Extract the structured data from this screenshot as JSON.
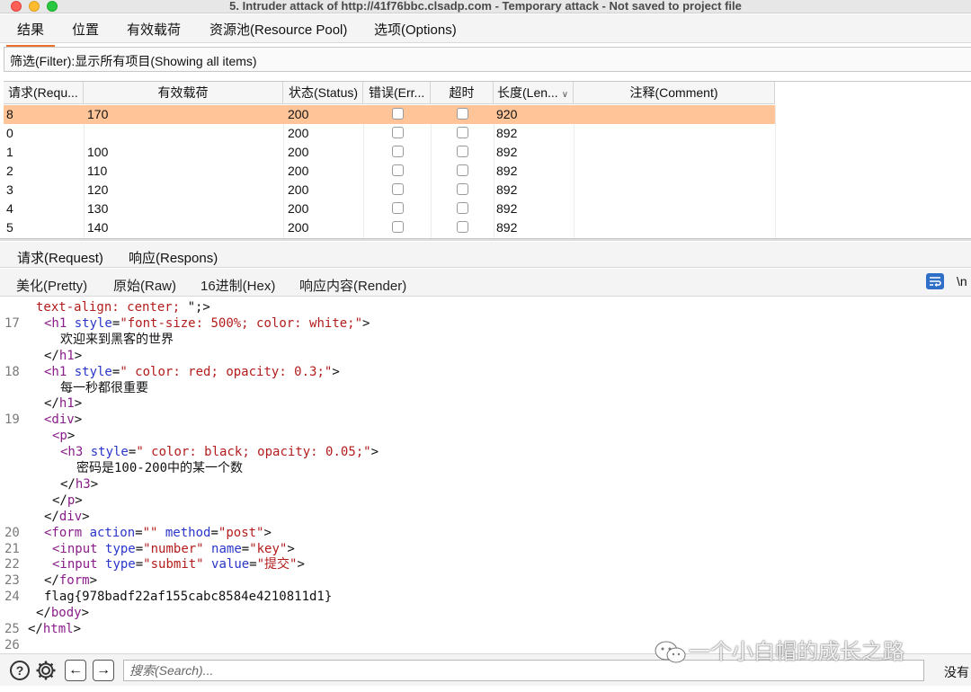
{
  "window": {
    "title": "5. Intruder attack of http://41f76bbc.clsadp.com - Temporary attack - Not saved to project file"
  },
  "main_tabs": [
    {
      "label": "结果",
      "active": true
    },
    {
      "label": "位置",
      "active": false
    },
    {
      "label": "有效载荷",
      "active": false
    },
    {
      "label": "资源池(Resource Pool)",
      "active": false
    },
    {
      "label": "选项(Options)",
      "active": false
    }
  ],
  "filter": {
    "label": "筛选(Filter):显示所有项目(Showing all items)"
  },
  "table": {
    "columns": [
      "请求(Requ...",
      "有效载荷",
      "状态(Status)",
      "错误(Err...",
      "超时",
      "长度(Len...",
      "注释(Comment)"
    ],
    "rows": [
      {
        "request": "8",
        "payload": "170",
        "status": "200",
        "error": false,
        "timeout": false,
        "length": "920",
        "comment": "",
        "selected": true
      },
      {
        "request": "0",
        "payload": "",
        "status": "200",
        "error": false,
        "timeout": false,
        "length": "892",
        "comment": "",
        "selected": false
      },
      {
        "request": "1",
        "payload": "100",
        "status": "200",
        "error": false,
        "timeout": false,
        "length": "892",
        "comment": "",
        "selected": false
      },
      {
        "request": "2",
        "payload": "110",
        "status": "200",
        "error": false,
        "timeout": false,
        "length": "892",
        "comment": "",
        "selected": false
      },
      {
        "request": "3",
        "payload": "120",
        "status": "200",
        "error": false,
        "timeout": false,
        "length": "892",
        "comment": "",
        "selected": false
      },
      {
        "request": "4",
        "payload": "130",
        "status": "200",
        "error": false,
        "timeout": false,
        "length": "892",
        "comment": "",
        "selected": false
      },
      {
        "request": "5",
        "payload": "140",
        "status": "200",
        "error": false,
        "timeout": false,
        "length": "892",
        "comment": "",
        "selected": false
      }
    ],
    "selected_color": "#ffc599"
  },
  "rr_tabs": [
    {
      "label": "请求(Request)",
      "active": false
    },
    {
      "label": "响应(Respons)",
      "active": true
    }
  ],
  "view_tabs": [
    {
      "label": "美化(Pretty)",
      "active": true
    },
    {
      "label": "原始(Raw)",
      "active": false
    },
    {
      "label": "16进制(Hex)",
      "active": false
    },
    {
      "label": "响应内容(Render)",
      "active": false
    }
  ],
  "toolbar_right": {
    "wrap_icon": "wrap-lines-icon",
    "newline_label": "\\n"
  },
  "code_lines": [
    {
      "num": "",
      "indent": 3,
      "tokens": [
        [
          "val",
          "text-align: center; "
        ],
        [
          "plain",
          "\";>"
        ]
      ]
    },
    {
      "num": "17",
      "indent": 4,
      "tokens": [
        [
          "tag",
          "<h1 "
        ],
        [
          "attr",
          "style"
        ],
        [
          "plain",
          "="
        ],
        [
          "val",
          "\"font-size: 500%; color: white;\""
        ],
        [
          "plain",
          ">"
        ]
      ]
    },
    {
      "num": "",
      "indent": 6,
      "tokens": [
        [
          "cn",
          "欢迎来到黑客的世界"
        ]
      ]
    },
    {
      "num": "",
      "indent": 4,
      "tokens": [
        [
          "plain",
          "</"
        ],
        [
          "tag",
          "h1"
        ],
        [
          "plain",
          ">"
        ]
      ]
    },
    {
      "num": "18",
      "indent": 4,
      "tokens": [
        [
          "tag",
          "<h1 "
        ],
        [
          "attr",
          "style"
        ],
        [
          "plain",
          "="
        ],
        [
          "val",
          "\" color: red; opacity: 0.3;\""
        ],
        [
          "plain",
          ">"
        ]
      ]
    },
    {
      "num": "",
      "indent": 6,
      "tokens": [
        [
          "cn",
          "每一秒都很重要"
        ]
      ]
    },
    {
      "num": "",
      "indent": 4,
      "tokens": [
        [
          "plain",
          "</"
        ],
        [
          "tag",
          "h1"
        ],
        [
          "plain",
          ">"
        ]
      ]
    },
    {
      "num": "19",
      "indent": 4,
      "tokens": [
        [
          "tag",
          "<div"
        ],
        [
          "plain",
          ">"
        ]
      ]
    },
    {
      "num": "",
      "indent": 5,
      "tokens": [
        [
          "tag",
          "<p"
        ],
        [
          "plain",
          ">"
        ]
      ]
    },
    {
      "num": "",
      "indent": 6,
      "tokens": [
        [
          "tag",
          "<h3 "
        ],
        [
          "attr",
          "style"
        ],
        [
          "plain",
          "="
        ],
        [
          "val",
          "\" color: black; opacity: 0.05;\""
        ],
        [
          "plain",
          ">"
        ]
      ]
    },
    {
      "num": "",
      "indent": 8,
      "tokens": [
        [
          "cn",
          "密码是"
        ],
        [
          "plain",
          "100-200"
        ],
        [
          "cn",
          "中的某一个数"
        ]
      ]
    },
    {
      "num": "",
      "indent": 6,
      "tokens": [
        [
          "plain",
          "</"
        ],
        [
          "tag",
          "h3"
        ],
        [
          "plain",
          ">"
        ]
      ]
    },
    {
      "num": "",
      "indent": 5,
      "tokens": [
        [
          "plain",
          "</"
        ],
        [
          "tag",
          "p"
        ],
        [
          "plain",
          ">"
        ]
      ]
    },
    {
      "num": "",
      "indent": 4,
      "tokens": [
        [
          "plain",
          "</"
        ],
        [
          "tag",
          "div"
        ],
        [
          "plain",
          ">"
        ]
      ]
    },
    {
      "num": "20",
      "indent": 4,
      "tokens": [
        [
          "tag",
          "<form "
        ],
        [
          "attr",
          "action"
        ],
        [
          "plain",
          "="
        ],
        [
          "val",
          "\"\""
        ],
        [
          "attr",
          " method"
        ],
        [
          "plain",
          "="
        ],
        [
          "val",
          "\"post\""
        ],
        [
          "plain",
          ">"
        ]
      ]
    },
    {
      "num": "21",
      "indent": 5,
      "tokens": [
        [
          "tag",
          "<input "
        ],
        [
          "attr",
          "type"
        ],
        [
          "plain",
          "="
        ],
        [
          "val",
          "\"number\""
        ],
        [
          "attr",
          " name"
        ],
        [
          "plain",
          "="
        ],
        [
          "val",
          "\"key\""
        ],
        [
          "plain",
          ">"
        ]
      ]
    },
    {
      "num": "22",
      "indent": 5,
      "tokens": [
        [
          "tag",
          "<input "
        ],
        [
          "attr",
          "type"
        ],
        [
          "plain",
          "="
        ],
        [
          "val",
          "\"submit\""
        ],
        [
          "attr",
          " value"
        ],
        [
          "plain",
          "="
        ],
        [
          "val",
          "\"提交\""
        ],
        [
          "plain",
          ">"
        ]
      ]
    },
    {
      "num": "23",
      "indent": 4,
      "tokens": [
        [
          "plain",
          "</"
        ],
        [
          "tag",
          "form"
        ],
        [
          "plain",
          ">"
        ]
      ]
    },
    {
      "num": "24",
      "indent": 4,
      "tokens": [
        [
          "plain",
          "flag{978badf22af155cabc8584e4210811d1}"
        ]
      ]
    },
    {
      "num": "",
      "indent": 3,
      "tokens": [
        [
          "plain",
          "</"
        ],
        [
          "tag",
          "body"
        ],
        [
          "plain",
          ">"
        ]
      ]
    },
    {
      "num": "25",
      "indent": 2,
      "tokens": [
        [
          "plain",
          "</"
        ],
        [
          "tag",
          "html"
        ],
        [
          "plain",
          ">"
        ]
      ]
    },
    {
      "num": "26",
      "indent": 0,
      "tokens": []
    }
  ],
  "bottom_bar": {
    "help_icon": "help-icon",
    "settings_icon": "gear-icon",
    "back_icon": "arrow-left-icon",
    "forward_icon": "arrow-right-icon",
    "search_placeholder": "搜索(Search)...",
    "no_match_label": "没有"
  },
  "watermark": {
    "text": "一个小白帽的成长之路",
    "icon": "wechat-icon"
  },
  "colors": {
    "accent_underline": "#e8702a",
    "tag": "#8a1d8a",
    "attr": "#2a36c9",
    "value": "#b31c1c",
    "wrap_button": "#2f6fc7"
  }
}
